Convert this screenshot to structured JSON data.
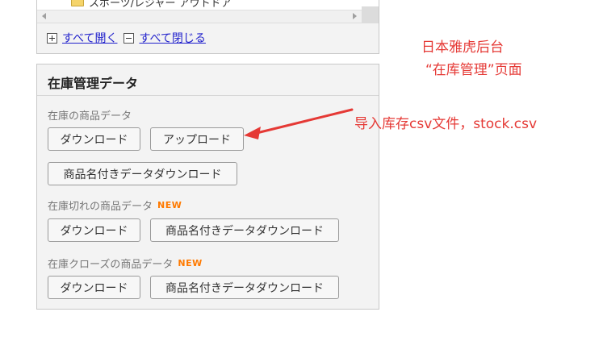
{
  "tree": {
    "item_label": "スポーツ/レジャー アウトドア",
    "expand_all": "すべて開く",
    "collapse_all": "すべて閉じる"
  },
  "inventory": {
    "title": "在庫管理データ",
    "sections": [
      {
        "label": "在庫の商品データ",
        "is_new": false,
        "buttons": [
          "ダウンロード",
          "アップロード",
          "商品名付きデータダウンロード"
        ]
      },
      {
        "label": "在庫切れの商品データ",
        "is_new": true,
        "new_badge": "NEW",
        "buttons": [
          "ダウンロード",
          "商品名付きデータダウンロード"
        ]
      },
      {
        "label": "在庫クローズの商品データ",
        "is_new": true,
        "new_badge": "NEW",
        "buttons": [
          "ダウンロード",
          "商品名付きデータダウンロード"
        ]
      }
    ]
  },
  "annotations": {
    "page_note_line1": "日本雅虎后台",
    "page_note_line2": "“在库管理”页面",
    "upload_note": "导入库存csv文件，stock.csv",
    "annotation_color": "#e53935",
    "new_badge_color": "#ff7a00"
  }
}
